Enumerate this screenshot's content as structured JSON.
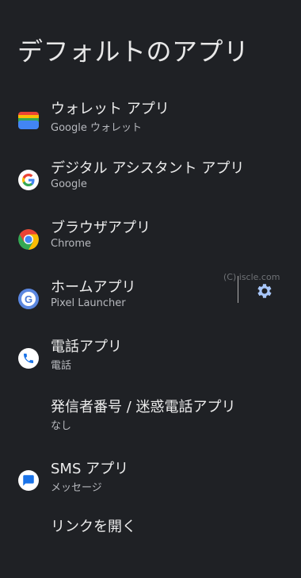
{
  "page": {
    "title": "デフォルトのアプリ"
  },
  "items": [
    {
      "label": "ウォレット アプリ",
      "value": "Google ウォレット",
      "icon": "wallet-icon"
    },
    {
      "label": "デジタル アシスタント アプリ",
      "value": "Google",
      "icon": "google-g-icon"
    },
    {
      "label": "ブラウザアプリ",
      "value": "Chrome",
      "icon": "chrome-icon"
    },
    {
      "label": "ホームアプリ",
      "value": "Pixel Launcher",
      "icon": "pixel-launcher-icon"
    },
    {
      "label": "電話アプリ",
      "value": "電話",
      "icon": "phone-icon"
    },
    {
      "label": "発信者番号 / 迷惑電話アプリ",
      "value": "なし"
    },
    {
      "label": "SMS アプリ",
      "value": "メッセージ",
      "icon": "messages-icon"
    },
    {
      "label": "リンクを開く"
    }
  ],
  "watermark": "(C) iscle.com",
  "colors": {
    "background": "#1f2125",
    "primary_text": "#ededed",
    "secondary_text": "#b7b9be",
    "accent": "#a8c7fa"
  }
}
